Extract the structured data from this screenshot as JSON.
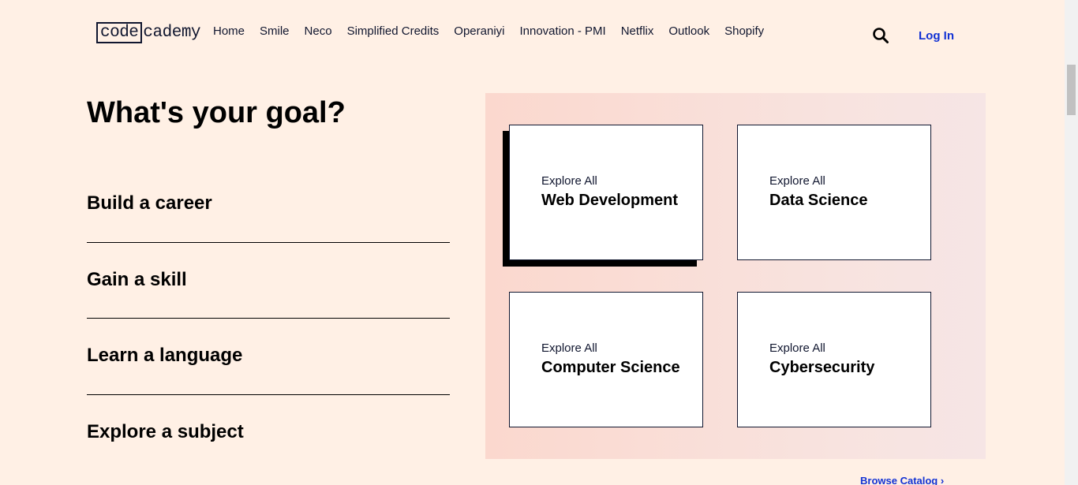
{
  "header": {
    "logo": {
      "code": "code",
      "cademy": "cademy"
    },
    "nav": [
      "Home",
      "Smile",
      "Neco",
      "Simplified Credits",
      "Operaniyi",
      "Innovation - PMI",
      "Netflix",
      "Outlook",
      "Shopify"
    ],
    "login_label": "Log In",
    "search_icon": "search-icon"
  },
  "goals": {
    "title": "What's your goal?",
    "items": [
      "Build a career",
      "Gain a skill",
      "Learn a language",
      "Explore a subject"
    ]
  },
  "explore": {
    "cards": [
      {
        "small": "Explore All",
        "title": "Web Development"
      },
      {
        "small": "Explore All",
        "title": "Data Science"
      },
      {
        "small": "Explore All",
        "title": "Computer Science"
      },
      {
        "small": "Explore All",
        "title": "Cybersecurity"
      }
    ],
    "browse_label": "Browse Catalog ›"
  },
  "colors": {
    "background": "#fff0e5",
    "navy": "#10162f",
    "link": "#1232d4",
    "panel_left": "#fbd8ce",
    "panel_right": "#f6e5e5"
  }
}
